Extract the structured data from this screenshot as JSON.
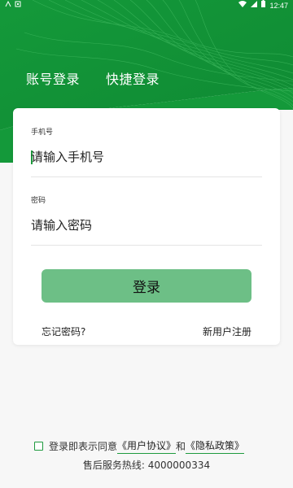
{
  "status_bar": {
    "time": "12:47",
    "left_icons": [
      "network-icon",
      "notification-icon"
    ],
    "right_icons": [
      "wifi-icon",
      "signal-icon",
      "battery-icon"
    ]
  },
  "tabs": [
    {
      "label": "账号登录"
    },
    {
      "label": "快捷登录"
    }
  ],
  "form": {
    "phone_label": "手机号",
    "phone_placeholder": "请输入手机号",
    "password_label": "密码",
    "password_placeholder": "请输入密码",
    "login_button": "登录",
    "forgot_password": "忘记密码?",
    "register": "新用户注册"
  },
  "agreement": {
    "prefix": "登录即表示同意",
    "user_agreement": "《用户协议》",
    "conjunction": "和",
    "privacy_policy": "《隐私政策》",
    "checked": false
  },
  "hotline": "售后服务热线: 4000000334",
  "colors": {
    "brand_green": "#1a9a3c",
    "button_green": "#6dbf86",
    "background": "#f7f7f7"
  }
}
